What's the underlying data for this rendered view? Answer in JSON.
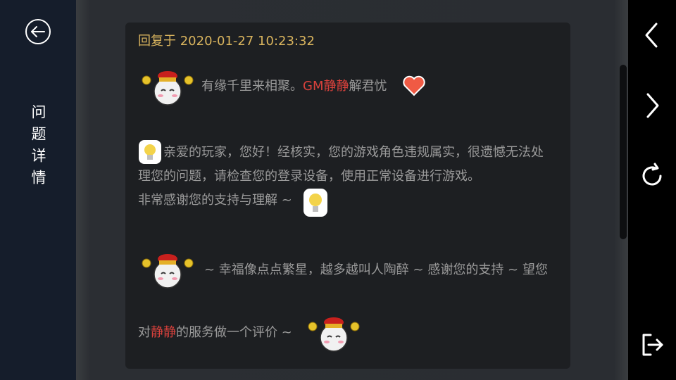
{
  "sidebar": {
    "title": "问题详情",
    "back_icon": "back-arrow-circle-icon"
  },
  "card": {
    "reply_time": "回复于 2020-01-27 10:23:32",
    "greeting_pre": "有缘千里来相聚。",
    "greeting_gm": "GM静静",
    "greeting_post": "解君忧",
    "body_para": "亲爱的玩家，您好！经核实，您的游戏角色违规属实，很遗憾无法处理您的问题，请检查您的登录设备，使用正常设备进行游戏。",
    "thanks_line": "非常感谢您的支持与理解 ~ ",
    "wish_line": "~ 幸福像点点繁星，越多越叫人陶醉 ~ 感谢您的支持 ~ 望您",
    "rate_pre": "对",
    "rate_name": "静静",
    "rate_post": "的服务做一个评价 ~"
  },
  "right_nav": {
    "icons": [
      "chevron-left-icon",
      "chevron-right-icon",
      "refresh-icon",
      "exit-icon"
    ]
  },
  "colors": {
    "left_bar": "#151d2b",
    "right_bar": "#000000",
    "card_bg": "#1d1f22",
    "time_gold": "#d9b45e",
    "text_gray": "#9a9a9a",
    "name_red": "#d9413c",
    "heart": "#f05a44"
  }
}
